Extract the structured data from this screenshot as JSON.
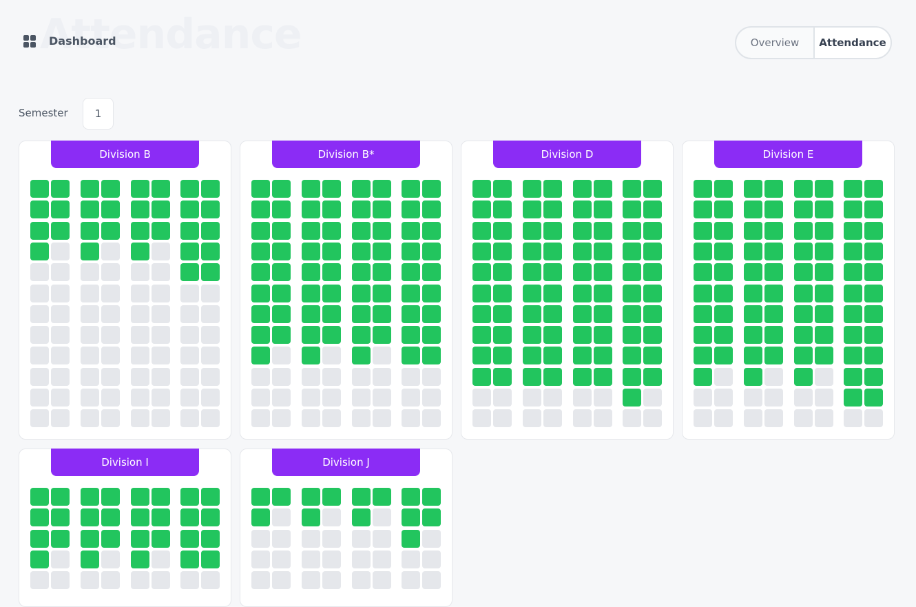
{
  "header": {
    "watermark": "Attendance",
    "title": "Dashboard",
    "icon": "grid-icon",
    "tabs": [
      {
        "label": "Overview",
        "active": false
      },
      {
        "label": "Attendance",
        "active": true
      }
    ]
  },
  "filter": {
    "semester_label": "Semester",
    "semester_value": "1"
  },
  "colors": {
    "present": "#22c55e",
    "empty": "#e5e7eb",
    "accent": "#8b2cf5"
  },
  "divisions": [
    {
      "name": "Division B",
      "rows": 12,
      "counts": [
        7,
        7,
        7,
        10
      ]
    },
    {
      "name": "Division B*",
      "rows": 12,
      "counts": [
        17,
        17,
        17,
        18
      ]
    },
    {
      "name": "Division D",
      "rows": 12,
      "counts": [
        20,
        20,
        20,
        21
      ]
    },
    {
      "name": "Division E",
      "rows": 12,
      "counts": [
        19,
        19,
        19,
        22
      ]
    },
    {
      "name": "Division I",
      "rows": 5,
      "counts": [
        7,
        7,
        7,
        8
      ]
    },
    {
      "name": "Division J",
      "rows": 5,
      "counts": [
        3,
        3,
        3,
        5
      ]
    }
  ]
}
